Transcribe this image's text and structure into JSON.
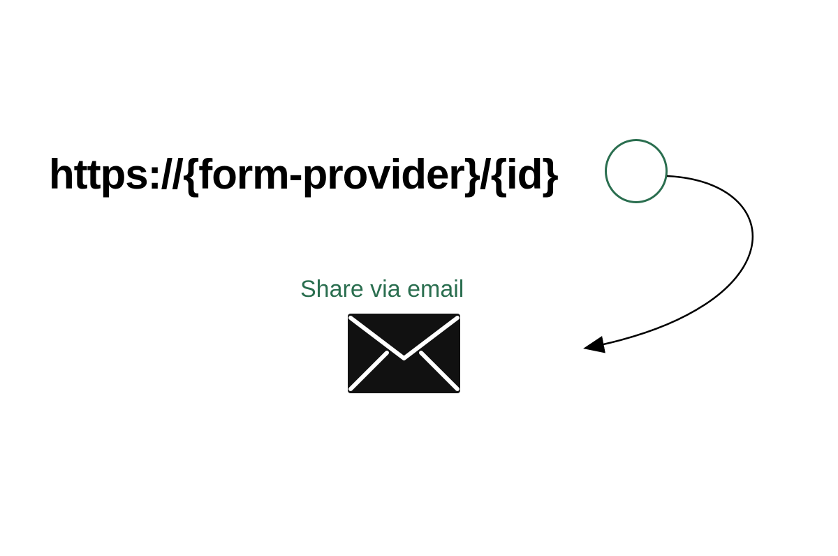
{
  "url_template": "https://{form-provider}/{id}",
  "highlighted_segment": "{id}",
  "share_label": "Share via email",
  "colors": {
    "text": "#000000",
    "accent": "#2a6e4f",
    "icon_fill": "#111111"
  },
  "icons": {
    "envelope": "envelope-icon"
  }
}
